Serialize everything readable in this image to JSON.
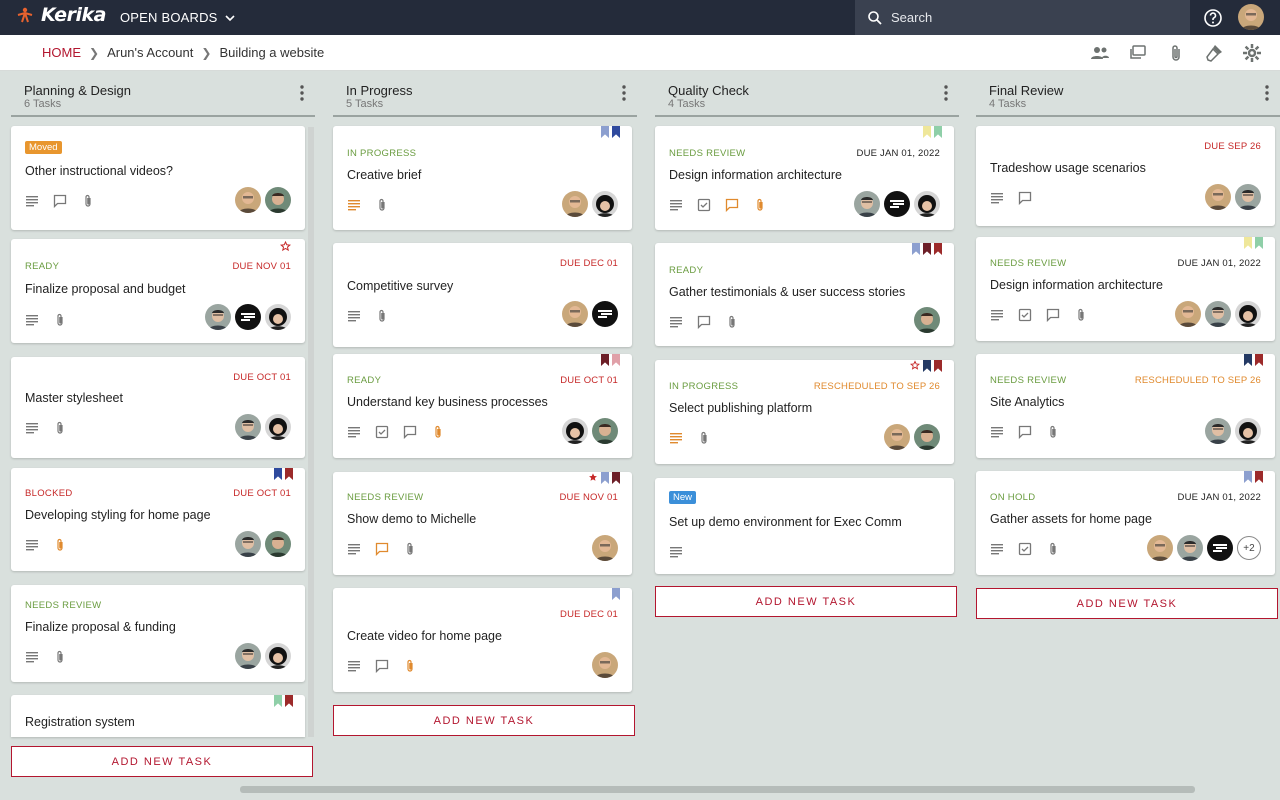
{
  "app": {
    "brand": "Kerika",
    "board_menu": "OPEN BOARDS",
    "search_label": "Search"
  },
  "breadcrumb": {
    "home": "HOME",
    "account": "Arun's Account",
    "board": "Building a website"
  },
  "icons": {
    "logo": "kerika-logo-icon",
    "board_menu": "chevron-down-icon",
    "search": "search-icon",
    "help": "help-icon",
    "team": "people-icon",
    "chat": "chat-icon",
    "attachments": "paperclip-icon",
    "highlights": "flashlight-icon",
    "settings": "gear-icon",
    "column_menu": "more-vert-icon",
    "details": "description-icon",
    "checklist": "checklist-icon",
    "comment": "comment-icon",
    "attachment": "attachment-icon",
    "star": "star-icon"
  },
  "colors": {
    "topbar": "#242b3a",
    "accent_red": "#b3162f",
    "status_green": "#6a9c40",
    "status_red": "#c62828",
    "orange": "#e08a2e",
    "chip_blue": "#3b8fd9",
    "flag_blue": "#2f4a9e",
    "flag_lightblue": "#8c9fcf",
    "flag_red": "#9c2a2a",
    "flag_darkred": "#6d1f28",
    "flag_pink": "#e0a0a8",
    "flag_yellow": "#efe79a",
    "flag_green": "#8fcfa8",
    "flag_navy": "#243a64"
  },
  "add_task_label": "ADD NEW TASK",
  "columns": [
    {
      "title": "Planning & Design",
      "count": "6 Tasks",
      "cards": [
        {
          "chip": "Moved",
          "title": "Other instructional videos?"
        },
        {
          "status": "READY",
          "due": "DUE NOV 01",
          "title": "Finalize proposal and budget"
        },
        {
          "due": "DUE OCT 01",
          "title": "Master stylesheet"
        },
        {
          "status": "BLOCKED",
          "due": "DUE OCT 01",
          "title": "Developing styling for home page"
        },
        {
          "status": "NEEDS REVIEW",
          "title": "Finalize proposal & funding"
        },
        {
          "title": "Registration system"
        }
      ]
    },
    {
      "title": "In Progress",
      "count": "5 Tasks",
      "cards": [
        {
          "status": "IN PROGRESS",
          "title": "Creative brief"
        },
        {
          "due": "DUE DEC 01",
          "title": "Competitive survey"
        },
        {
          "status": "READY",
          "due": "DUE OCT 01",
          "title": "Understand key business processes"
        },
        {
          "status": "NEEDS REVIEW",
          "due": "DUE NOV 01",
          "title": "Show demo to Michelle"
        },
        {
          "due": "DUE DEC 01",
          "title": "Create video for home page"
        }
      ]
    },
    {
      "title": "Quality Check",
      "count": "4 Tasks",
      "cards": [
        {
          "status": "NEEDS REVIEW",
          "due": "DUE JAN 01, 2022",
          "title": "Design information architecture"
        },
        {
          "status": "READY",
          "title": "Gather testimonials & user success stories"
        },
        {
          "status": "IN PROGRESS",
          "due": "RESCHEDULED TO SEP 26",
          "title": "Select publishing platform"
        },
        {
          "chip": "New",
          "title": "Set up demo environment for Exec Comm"
        }
      ]
    },
    {
      "title": "Final Review",
      "count": "4 Tasks",
      "cards": [
        {
          "due": "DUE SEP 26",
          "title": "Tradeshow usage scenarios"
        },
        {
          "status": "NEEDS REVIEW",
          "due": "DUE JAN 01, 2022",
          "title": "Design information architecture"
        },
        {
          "status": "NEEDS REVIEW",
          "due": "RESCHEDULED TO SEP 26",
          "title": "Site Analytics"
        },
        {
          "status": "ON HOLD",
          "due": "DUE JAN 01, 2022",
          "title": "Gather assets for home page",
          "extra_members": "+2"
        }
      ]
    }
  ]
}
